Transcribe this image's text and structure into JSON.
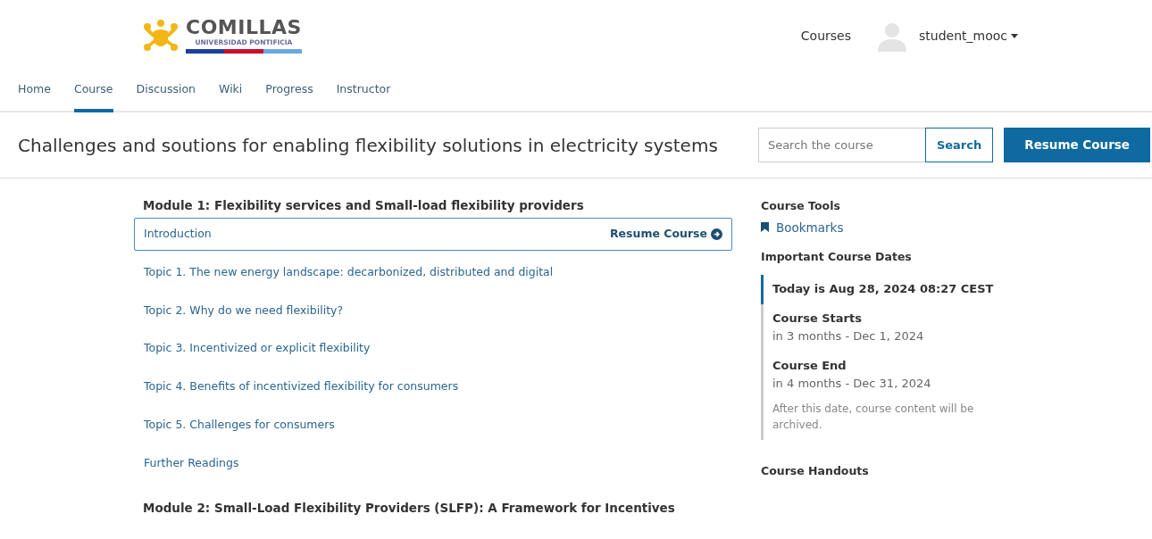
{
  "header": {
    "logo": {
      "name": "COMILLAS",
      "subtitle": "UNIVERSIDAD PONTIFICIA"
    },
    "courses_link": "Courses",
    "username": "student_mooc"
  },
  "tabs": [
    {
      "label": "Home",
      "selected": false
    },
    {
      "label": "Course",
      "selected": true
    },
    {
      "label": "Discussion",
      "selected": false
    },
    {
      "label": "Wiki",
      "selected": false
    },
    {
      "label": "Progress",
      "selected": false
    },
    {
      "label": "Instructor",
      "selected": false
    }
  ],
  "course_title": "Challenges and soutions for enabling flexibility solutions in electricity systems",
  "search": {
    "placeholder": "Search the course",
    "button": "Search"
  },
  "resume_button": "Resume Course",
  "modules": [
    {
      "title": "Module 1: Flexibility services and Small-load flexibility providers",
      "sections": [
        {
          "title": "Introduction",
          "last_accessed": true,
          "resume_label": "Resume Course"
        },
        {
          "title": "Topic 1. The new energy landscape: decarbonized, distributed and digital",
          "last_accessed": false
        },
        {
          "title": "Topic 2. Why do we need flexibility?",
          "last_accessed": false
        },
        {
          "title": "Topic 3. Incentivized or explicit flexibility",
          "last_accessed": false
        },
        {
          "title": "Topic 4. Benefits of incentivized flexibility for consumers",
          "last_accessed": false
        },
        {
          "title": "Topic 5. Challenges for consumers",
          "last_accessed": false
        },
        {
          "title": "Further Readings",
          "last_accessed": false
        }
      ]
    },
    {
      "title": "Module 2: Small-Load Flexibility Providers (SLFP): A Framework for Incentives"
    }
  ],
  "sidebar": {
    "tools_title": "Course Tools",
    "tools": [
      "Bookmarks"
    ],
    "dates_title": "Important Course Dates",
    "dates": [
      {
        "title": "Today is Aug 28, 2024 08:27 CEST",
        "current": true
      },
      {
        "title": "Course Starts",
        "subtitle": "in 3 months - Dec 1, 2024",
        "current": false
      },
      {
        "title": "Course End",
        "subtitle": "in 4 months - Dec 31, 2024",
        "note": "After this date, course content will be archived.",
        "current": false
      }
    ],
    "handouts_title": "Course Handouts"
  }
}
